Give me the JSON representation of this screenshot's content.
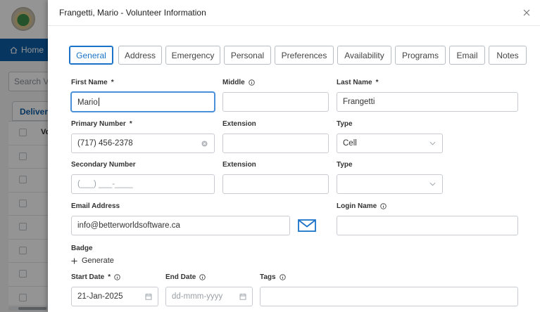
{
  "background": {
    "nav_home_label": "Home",
    "search_placeholder": "Search Vo",
    "tab_label": "Delivery",
    "table_header": "Vo"
  },
  "modal": {
    "title": "Frangetti, Mario - Volunteer Information",
    "tabs": [
      {
        "label": "General",
        "active": true
      },
      {
        "label": "Address"
      },
      {
        "label": "Emergency"
      },
      {
        "label": "Personal"
      },
      {
        "label": "Preferences"
      },
      {
        "label": "Availability"
      },
      {
        "label": "Programs"
      },
      {
        "label": "Email"
      },
      {
        "label": "Notes"
      }
    ]
  },
  "form": {
    "first_name": {
      "label": "First Name",
      "required": "*",
      "value": "Mario"
    },
    "middle": {
      "label": "Middle",
      "value": ""
    },
    "last_name": {
      "label": "Last Name",
      "required": "*",
      "value": "Frangetti"
    },
    "primary_number": {
      "label": "Primary Number",
      "required": "*",
      "value": "(717) 456-2378"
    },
    "extension_1": {
      "label": "Extension",
      "value": ""
    },
    "type_1": {
      "label": "Type",
      "value": "Cell"
    },
    "secondary_number": {
      "label": "Secondary Number",
      "placeholder": "(___) ___-____"
    },
    "extension_2": {
      "label": "Extension",
      "value": ""
    },
    "type_2": {
      "label": "Type",
      "value": ""
    },
    "email": {
      "label": "Email Address",
      "value": "info@betterworldsoftware.ca"
    },
    "login_name": {
      "label": "Login Name",
      "value": ""
    },
    "badge": {
      "label": "Badge",
      "generate_label": "Generate"
    },
    "start_date": {
      "label": "Start Date",
      "required": "*",
      "value": "21-Jan-2025"
    },
    "end_date": {
      "label": "End Date",
      "placeholder": "dd-mmm-yyyy"
    },
    "tags": {
      "label": "Tags",
      "value": ""
    }
  },
  "colors": {
    "accent": "#1a73c8",
    "nav_bar": "#0d5fa8",
    "focus_border": "#4a90d9"
  }
}
